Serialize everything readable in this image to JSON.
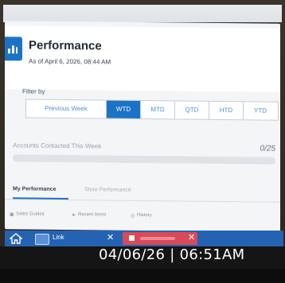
{
  "header": {
    "title": "Performance",
    "subtitle": "As of April 6, 2026, 08:44 AM"
  },
  "filter": {
    "label": "Filter by",
    "options": [
      "Previous Week",
      "WTD",
      "MTD",
      "QTD",
      "HTD",
      "YTD"
    ],
    "selected": "WTD"
  },
  "accounts": {
    "label": "Accounts Contacted This Week",
    "count": "0/25",
    "progress_fraction": 0
  },
  "tabs": [
    {
      "label": "My Performance",
      "active": true
    },
    {
      "label": "Store Performance",
      "active": false
    }
  ],
  "links": [
    {
      "label": "Sales Guides",
      "icon": "book-icon"
    },
    {
      "label": "Recent Items",
      "icon": "pin-icon"
    },
    {
      "label": "History",
      "icon": "clock-icon"
    }
  ],
  "taskbar": {
    "link_label": "Link"
  },
  "timestamp": "04/06/26 | 06:51AM",
  "colors": {
    "accent": "#1b73c7",
    "taskbar": "#2463b3",
    "red_tab": "#d94a57"
  }
}
